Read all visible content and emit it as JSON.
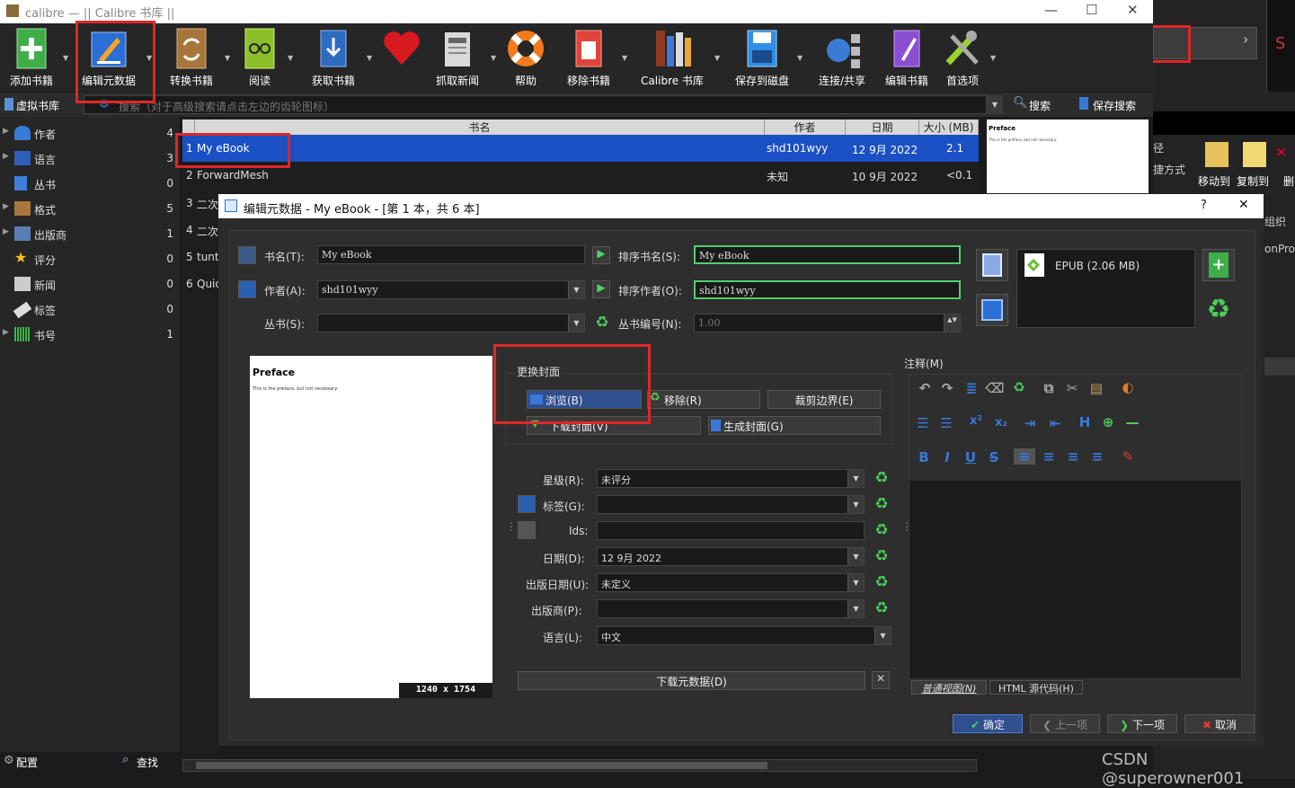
{
  "window": {
    "app_title": "calibre — || Calibre 书库 ||"
  },
  "toolbar": {
    "items": [
      {
        "label": "添加书籍",
        "icon": "add-book-icon"
      },
      {
        "label": "编辑元数据",
        "icon": "edit-metadata-icon"
      },
      {
        "label": "转换书籍",
        "icon": "convert-books-icon"
      },
      {
        "label": "阅读",
        "icon": "read-book-icon"
      },
      {
        "label": "获取书籍",
        "icon": "get-books-icon"
      },
      {
        "label": "",
        "icon": "heart-icon"
      },
      {
        "label": "抓取新闻",
        "icon": "fetch-news-icon"
      },
      {
        "label": "帮助",
        "icon": "help-lifebuoy-icon"
      },
      {
        "label": "移除书籍",
        "icon": "remove-books-icon"
      },
      {
        "label": "Calibre 书库",
        "icon": "library-icon"
      },
      {
        "label": "保存到磁盘",
        "icon": "save-disk-icon"
      },
      {
        "label": "连接/共享",
        "icon": "connect-share-icon"
      },
      {
        "label": "编辑书籍",
        "icon": "edit-book-icon"
      },
      {
        "label": "首选项",
        "icon": "preferences-icon"
      }
    ]
  },
  "right_panel": {
    "move_to": "移动到",
    "copy_to": "复制到",
    "text_a": "径",
    "text_b": "捷方式",
    "text_c": "组织",
    "text_d": "onPro",
    "text_e": "删"
  },
  "search": {
    "virtual_library": "虚拟书库",
    "placeholder": "搜索（对于高级搜索请点击左边的齿轮图标）",
    "search_label": "搜索",
    "save_search_label": "保存搜索"
  },
  "sidebar": {
    "items": [
      {
        "label": "作者",
        "count": "4"
      },
      {
        "label": "语言",
        "count": "3"
      },
      {
        "label": "丛书",
        "count": "0"
      },
      {
        "label": "格式",
        "count": "5"
      },
      {
        "label": "出版商",
        "count": "1"
      },
      {
        "label": "评分",
        "count": "0"
      },
      {
        "label": "新闻",
        "count": "0"
      },
      {
        "label": "标签",
        "count": "0"
      },
      {
        "label": "书号",
        "count": "1"
      }
    ],
    "configure": "配置",
    "find": "查找"
  },
  "booklist": {
    "headers": {
      "title": "书名",
      "author": "作者",
      "date": "日期",
      "size": "大小 (MB)"
    },
    "rows": [
      {
        "num": "1",
        "title": "My eBook",
        "author": "shd101wyy",
        "date": "12 9月 2022",
        "size": "2.1"
      },
      {
        "num": "2",
        "title": "ForwardMesh",
        "author": "未知",
        "date": "10 9月 2022",
        "size": "<0.1"
      },
      {
        "num": "3",
        "title": "二次"
      },
      {
        "num": "4",
        "title": "二次"
      },
      {
        "num": "5",
        "title": "tunt"
      },
      {
        "num": "6",
        "title": "Quic"
      }
    ]
  },
  "preview": {
    "heading": "Preface",
    "text": "This is the preface, but not necessary."
  },
  "dialog": {
    "title": "编辑元数据 - My eBook -  [第 1 本，共 6 本]",
    "help": "?",
    "close": "✕",
    "title_label": "书名(T):",
    "title_value": "My eBook",
    "sort_title_label": "排序书名(S):",
    "sort_title_value": "My eBook",
    "author_label": "作者(A):",
    "author_value": "shd101wyy",
    "sort_author_label": "排序作者(O):",
    "sort_author_value": "shd101wyy",
    "series_label": "丛书(S):",
    "series_value": "",
    "series_index_label": "丛书编号(N):",
    "series_index_value": "1.00",
    "format": "EPUB (2.06 MB)",
    "cover": {
      "heading": "Preface",
      "text": "This is the preface, but not necessary.",
      "size": "1240 x 1754"
    },
    "change_cover": "更换封面",
    "browse": "浏览(B)",
    "remove": "移除(R)",
    "trim": "裁剪边界(E)",
    "download_cover": "下载封面(V)",
    "generate_cover": "生成封面(G)",
    "rating_label": "星级(R):",
    "rating_value": "未评分",
    "tags_label": "标签(G):",
    "tags_value": "",
    "ids_label": "Ids:",
    "ids_value": "",
    "date_label": "日期(D):",
    "date_value": "12 9月 2022",
    "pubdate_label": "出版日期(U):",
    "pubdate_value": "未定义",
    "publisher_label": "出版商(P):",
    "publisher_value": "",
    "language_label": "语言(L):",
    "language_value": "中文",
    "download_metadata": "下载元数据(D)",
    "comments_label": "注释(M)",
    "normal_view": "普通视图(N)",
    "html_source": "HTML 源代码(H)",
    "ok": "确定",
    "prev": "上一项",
    "next": "下一项",
    "cancel": "取消"
  },
  "watermark": "CSDN @superowner001"
}
